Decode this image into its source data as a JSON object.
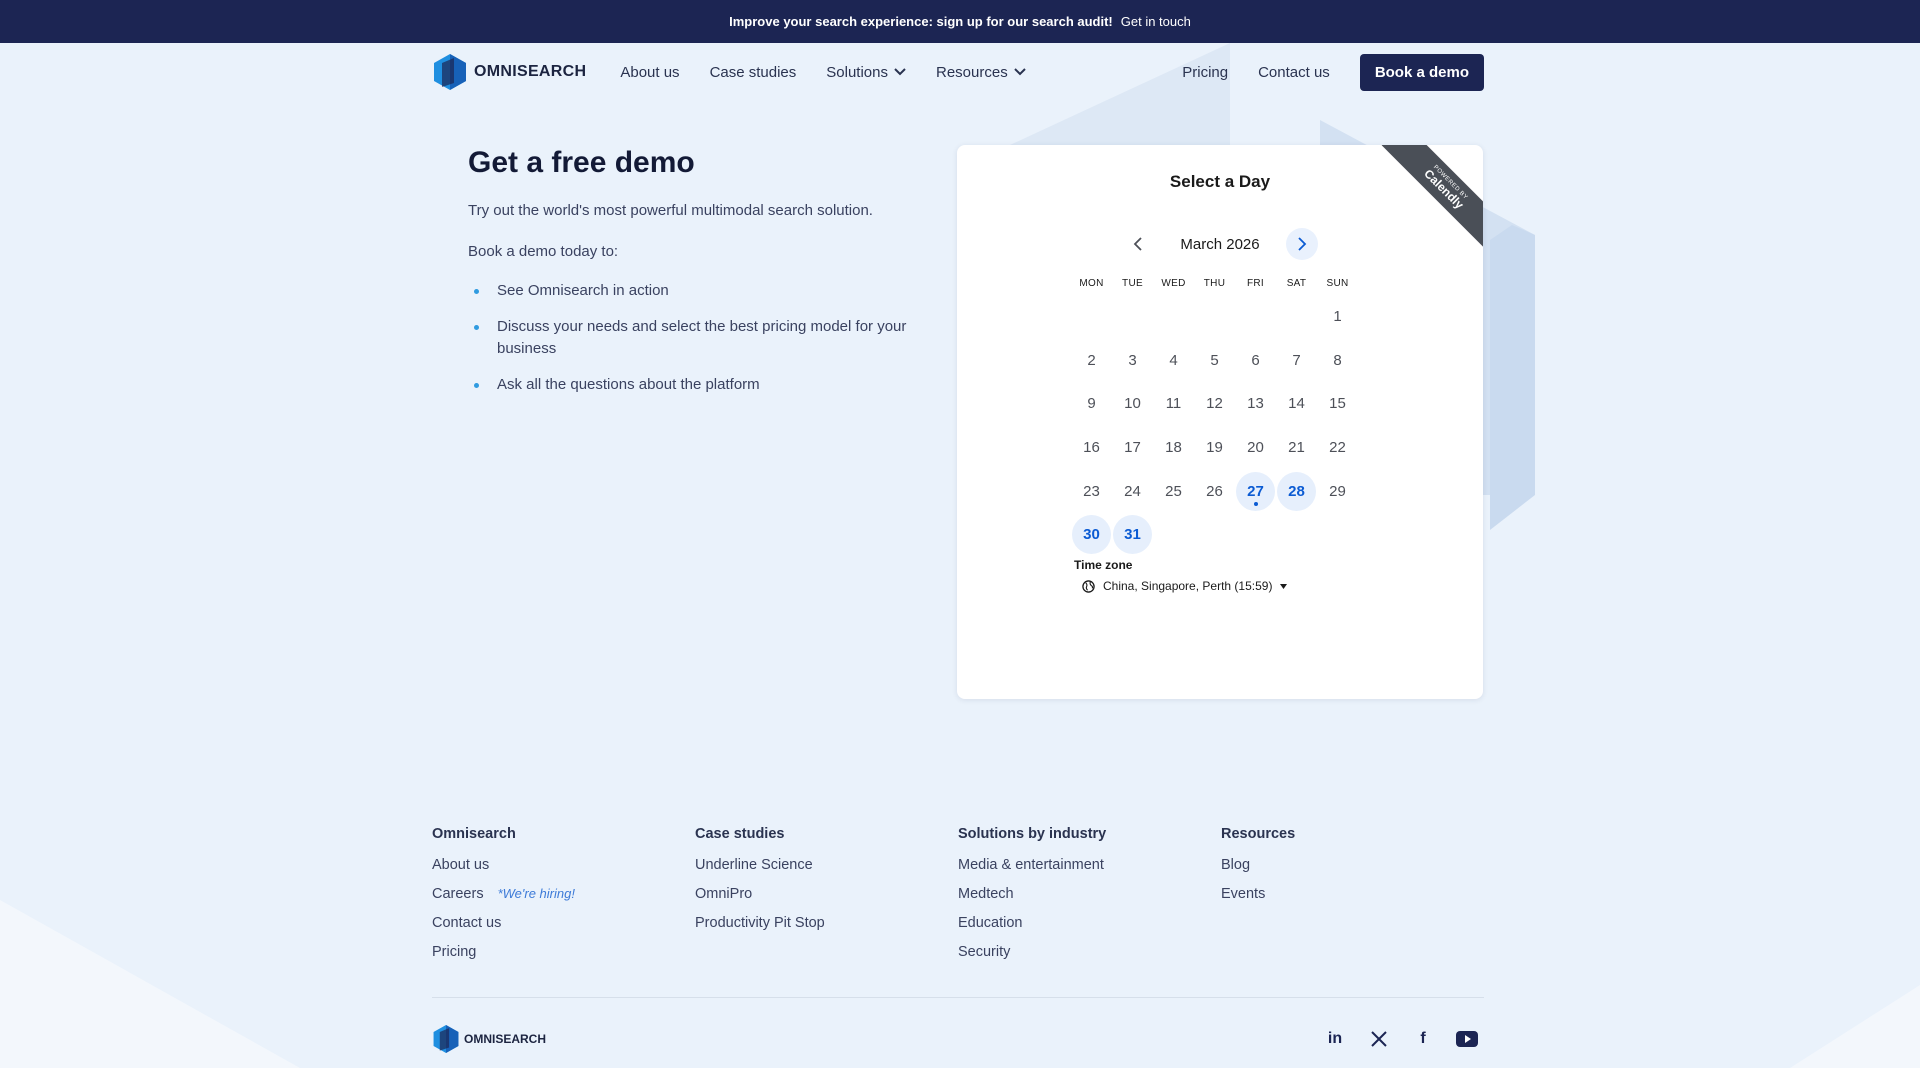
{
  "banner": {
    "message": "Improve your search experience: sign up for our search audit!",
    "cta": "Get in touch"
  },
  "nav": {
    "logo_text": "OMNISEARCH",
    "links": [
      {
        "label": "About us"
      },
      {
        "label": "Case studies"
      },
      {
        "label": "Solutions"
      },
      {
        "label": "Resources"
      }
    ],
    "pricing": "Pricing",
    "contact": "Contact us",
    "book_demo": "Book a demo"
  },
  "hero": {
    "title": "Get a free demo",
    "subtitle": "Try out the world's most powerful multimodal search solution.",
    "lead": "Book a demo today to:",
    "bullets": [
      "See Omnisearch in action",
      "Discuss your needs and select the best pricing model for your business",
      "Ask all the questions about the platform"
    ]
  },
  "calendar": {
    "ribbon_small": "POWERED BY",
    "ribbon_brand": "Calendly",
    "title": "Select a Day",
    "month": "March 2026",
    "days_of_week": [
      "MON",
      "TUE",
      "WED",
      "THU",
      "FRI",
      "SAT",
      "SUN"
    ],
    "weeks": [
      [
        "",
        "",
        "",
        "",
        "",
        "",
        "1"
      ],
      [
        "2",
        "3",
        "4",
        "5",
        "6",
        "7",
        "8"
      ],
      [
        "9",
        "10",
        "11",
        "12",
        "13",
        "14",
        "15"
      ],
      [
        "16",
        "17",
        "18",
        "19",
        "20",
        "21",
        "22"
      ],
      [
        "23",
        "24",
        "25",
        "26",
        "27",
        "28",
        "29"
      ],
      [
        "30",
        "31",
        "",
        "",
        "",
        "",
        ""
      ]
    ],
    "available_days": [
      "27",
      "28",
      "30",
      "31"
    ],
    "today": "27",
    "timezone_label": "Time zone",
    "timezone_value": "China, Singapore, Perth (15:59)",
    "accent_color": "#0b5bd3"
  },
  "footer": {
    "columns": [
      {
        "heading": "Omnisearch",
        "links": [
          "About us",
          "Careers",
          "Contact us",
          "Pricing"
        ]
      },
      {
        "heading": "Case studies",
        "links": [
          "Underline Science",
          "OmniPro",
          "Productivity Pit Stop"
        ]
      },
      {
        "heading": "Solutions by industry",
        "links": [
          "Media & entertainment",
          "Medtech",
          "Education",
          "Security"
        ]
      },
      {
        "heading": "Resources",
        "links": [
          "Blog",
          "Events"
        ]
      }
    ],
    "hiring_note": "*We're hiring!",
    "logo_text": "OMNISEARCH",
    "socials": [
      {
        "icon": "linkedin-icon",
        "text": "in"
      },
      {
        "icon": "x-icon",
        "text": ""
      },
      {
        "icon": "facebook-icon",
        "text": "f"
      },
      {
        "icon": "youtube-icon",
        "text": ""
      }
    ]
  },
  "colors": {
    "navy": "#1c2553",
    "background": "#eaf2fb",
    "bullet": "#2f9be0"
  }
}
